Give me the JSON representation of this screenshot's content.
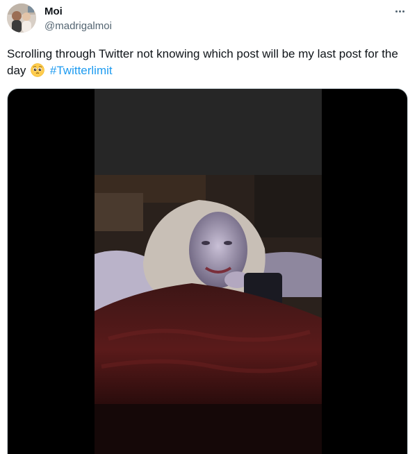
{
  "user": {
    "display_name": "Moi",
    "handle": "@madrigalmoi",
    "avatar_icon": "avatar-photo"
  },
  "tweet": {
    "text_before": "Scrolling through Twitter not knowing which post will be my last post for the day",
    "emoji": "pleading-face-emoji",
    "hashtag": "#Twitterlimit"
  },
  "more_icon": "more-options-icon",
  "media": {
    "type": "video",
    "description_icon": "video-thumbnail"
  },
  "colors": {
    "link": "#1d9bf0",
    "secondary_text": "#536471",
    "media_bg": "#000000"
  }
}
